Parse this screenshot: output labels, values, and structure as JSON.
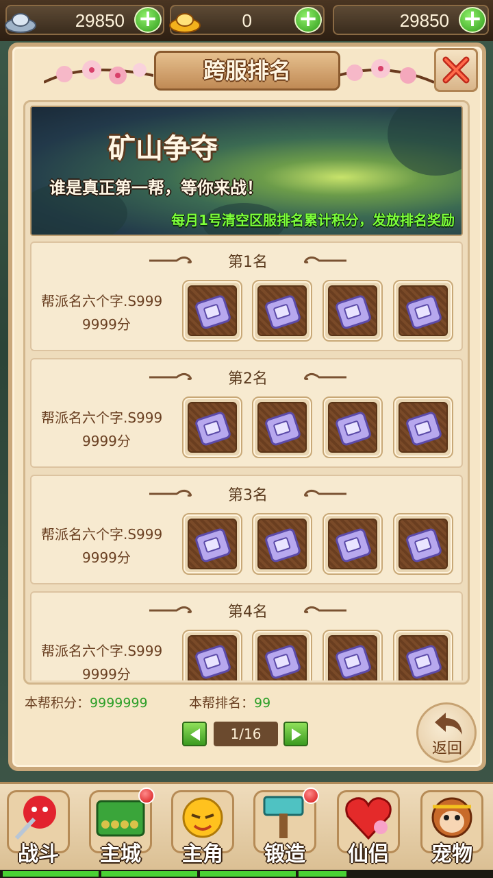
{
  "currency": {
    "silver": "29850",
    "gold": "0",
    "third": "29850"
  },
  "panel": {
    "title": "跨服排名"
  },
  "banner": {
    "title": "矿山争夺",
    "subtitle": "谁是真正第一帮，等你来战！",
    "note": "每月1号清空区服排名累计积分，发放排名奖励"
  },
  "ranks": [
    {
      "rank": "第1名",
      "guild_line1": "帮派名六个字.S999",
      "guild_line2": "9999分"
    },
    {
      "rank": "第2名",
      "guild_line1": "帮派名六个字.S999",
      "guild_line2": "9999分"
    },
    {
      "rank": "第3名",
      "guild_line1": "帮派名六个字.S999",
      "guild_line2": "9999分"
    },
    {
      "rank": "第4名",
      "guild_line1": "帮派名六个字.S999",
      "guild_line2": "9999分"
    }
  ],
  "footer": {
    "score_label": "本帮积分：",
    "score_value": "9999999",
    "rank_label": "本帮排名：",
    "rank_value": "99",
    "page": "1/16",
    "back_label": "返回"
  },
  "nav": [
    {
      "label": "战斗",
      "icon": "battle-icon"
    },
    {
      "label": "主城",
      "icon": "city-icon"
    },
    {
      "label": "主角",
      "icon": "hero-icon"
    },
    {
      "label": "锻造",
      "icon": "forge-icon"
    },
    {
      "label": "仙侣",
      "icon": "partner-icon"
    },
    {
      "label": "宠物",
      "icon": "pet-icon"
    }
  ],
  "colors": {
    "accent_green": "#2fa02a",
    "banner_note": "#7dff3a",
    "badge_red": "#d41414"
  }
}
